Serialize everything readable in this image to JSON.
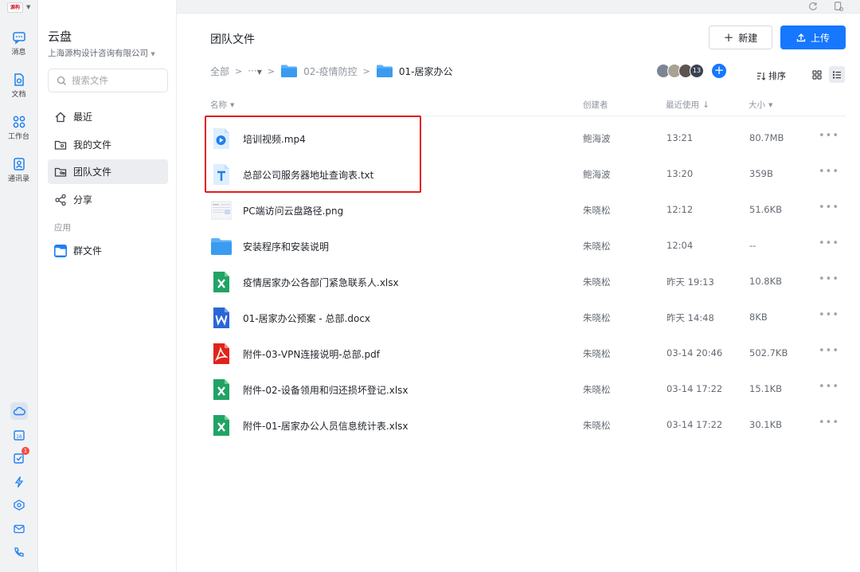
{
  "rail": {
    "items": [
      {
        "label": "消息",
        "icon": "message-icon"
      },
      {
        "label": "文档",
        "icon": "doc-icon"
      },
      {
        "label": "工作台",
        "icon": "workspace-icon"
      },
      {
        "label": "通讯录",
        "icon": "contacts-icon"
      }
    ],
    "bottom_icons": [
      "cloud-icon",
      "calendar-icon",
      "task-icon",
      "lightning-icon",
      "layers-icon",
      "mail-icon",
      "phone-icon"
    ],
    "calendar_day": "16",
    "task_badge": "1"
  },
  "sidebar": {
    "title": "云盘",
    "org": "上海源构设计咨询有限公司",
    "search_placeholder": "搜索文件",
    "nav": [
      {
        "label": "最近",
        "icon": "home-icon"
      },
      {
        "label": "我的文件",
        "icon": "my-files-icon"
      },
      {
        "label": "团队文件",
        "icon": "team-files-icon"
      },
      {
        "label": "分享",
        "icon": "share-icon"
      }
    ],
    "section": "应用",
    "app_item": "群文件"
  },
  "main": {
    "title": "团队文件",
    "new_label": "新建",
    "upload_label": "上传",
    "breadcrumb": {
      "root": "全部",
      "ellipsis": "···",
      "level1": "02-疫情防控",
      "current": "01-居家办公"
    },
    "member_count": "13",
    "sort_label": "排序",
    "columns": {
      "name": "名称",
      "creator": "创建者",
      "recent": "最近使用",
      "size": "大小"
    },
    "accent": "#1677ff",
    "files": [
      {
        "name": "培训视频.mp4",
        "type": "video",
        "creator": "鲍海波",
        "time": "13:21",
        "size": "80.7MB"
      },
      {
        "name": "总部公司服务器地址查询表.txt",
        "type": "text",
        "creator": "鲍海波",
        "time": "13:20",
        "size": "359B"
      },
      {
        "name": "PC端访问云盘路径.png",
        "type": "image",
        "creator": "朱晓松",
        "time": "12:12",
        "size": "51.6KB"
      },
      {
        "name": "安装程序和安装说明",
        "type": "folder",
        "creator": "朱晓松",
        "time": "12:04",
        "size": "--"
      },
      {
        "name": "疫情居家办公各部门紧急联系人.xlsx",
        "type": "excel",
        "creator": "朱晓松",
        "time": "昨天 19:13",
        "size": "10.8KB"
      },
      {
        "name": "01-居家办公预案 - 总部.docx",
        "type": "word",
        "creator": "朱晓松",
        "time": "昨天 14:48",
        "size": "8KB"
      },
      {
        "name": "附件-03-VPN连接说明-总部.pdf",
        "type": "pdf",
        "creator": "朱晓松",
        "time": "03-14 20:46",
        "size": "502.7KB"
      },
      {
        "name": "附件-02-设备领用和归还损坏登记.xlsx",
        "type": "excel",
        "creator": "朱晓松",
        "time": "03-14 17:22",
        "size": "15.1KB"
      },
      {
        "name": "附件-01-居家办公人员信息统计表.xlsx",
        "type": "excel",
        "creator": "朱晓松",
        "time": "03-14 17:22",
        "size": "30.1KB"
      }
    ]
  }
}
